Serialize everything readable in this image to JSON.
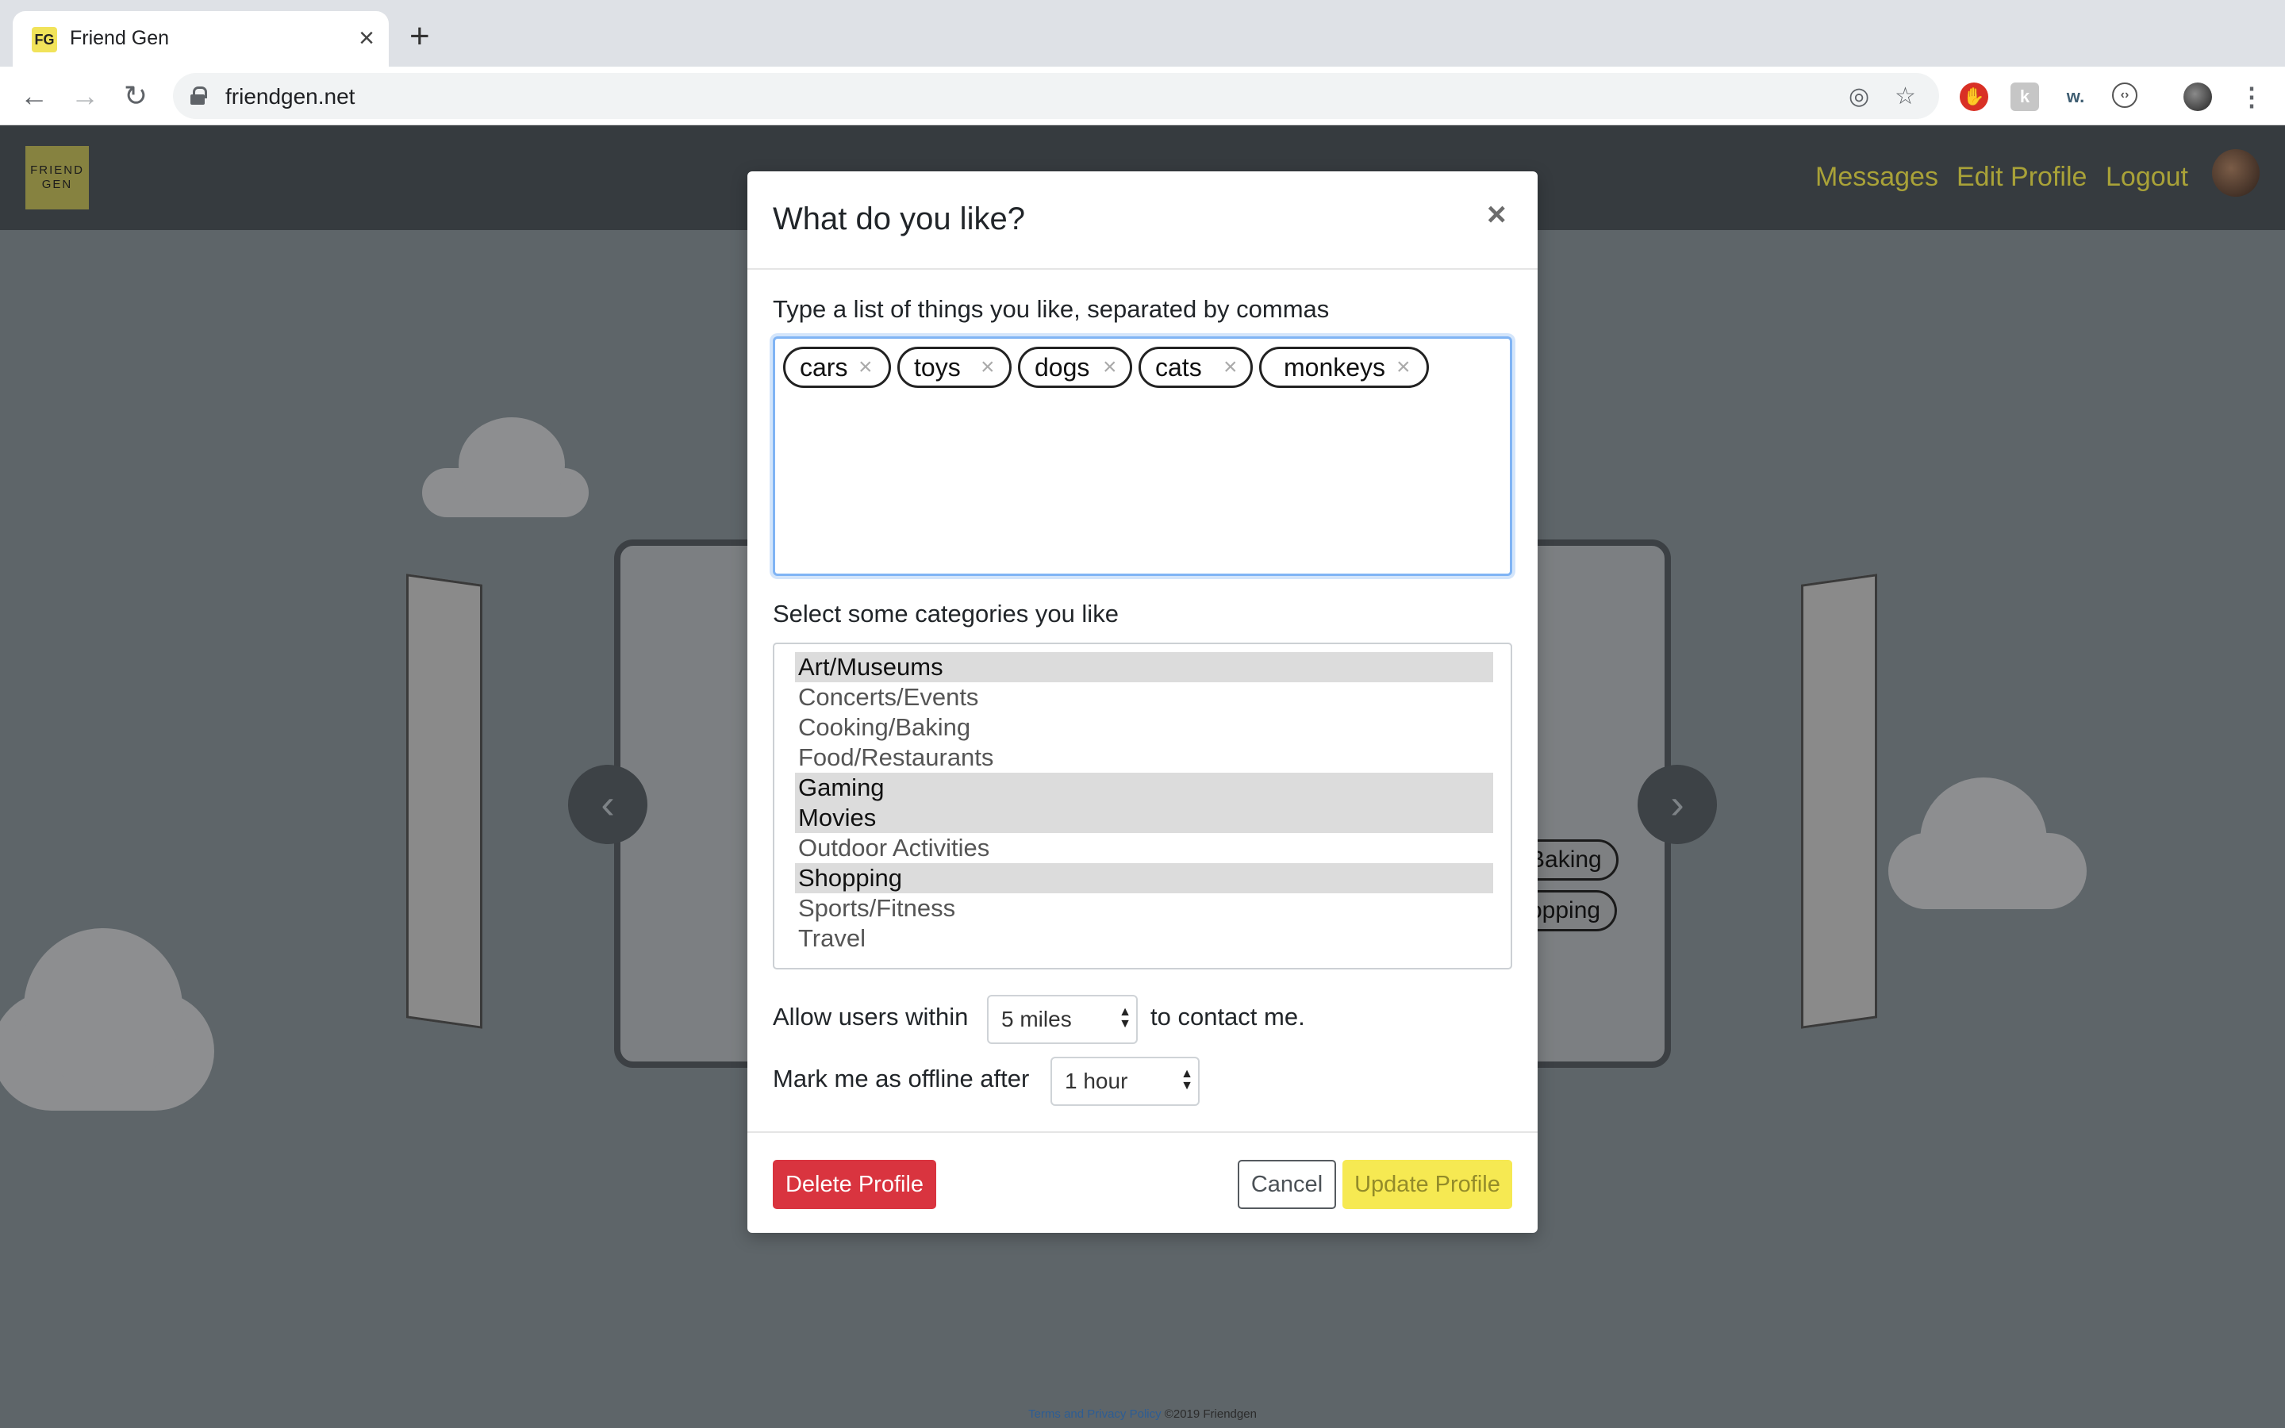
{
  "browser": {
    "tab_title": "Friend Gen",
    "favicon_text": "FG",
    "url": "friendgen.net"
  },
  "site": {
    "logo_line1": "FRIEND",
    "logo_line2": "GEN",
    "nav": {
      "messages": "Messages",
      "edit_profile": "Edit Profile",
      "logout": "Logout"
    },
    "nav_color": "#a9a238",
    "background_tags": [
      "Baking",
      "opping"
    ],
    "footer": {
      "terms_link": "Terms and Privacy Policy",
      "copyright": "©2019 Friendgen"
    }
  },
  "modal": {
    "title": "What do you like?",
    "likes_label": "Type a list of things you like, separated by commas",
    "tags": [
      "cars",
      "toys",
      "dogs",
      "cats",
      "monkeys"
    ],
    "categories_label": "Select some categories you like",
    "categories": [
      {
        "label": "Art/Museums",
        "selected": true
      },
      {
        "label": "Concerts/Events",
        "selected": false
      },
      {
        "label": "Cooking/Baking",
        "selected": false
      },
      {
        "label": "Food/Restaurants",
        "selected": false
      },
      {
        "label": "Gaming",
        "selected": true
      },
      {
        "label": "Movies",
        "selected": true
      },
      {
        "label": "Outdoor Activities",
        "selected": false
      },
      {
        "label": "Shopping",
        "selected": true
      },
      {
        "label": "Sports/Fitness",
        "selected": false
      },
      {
        "label": "Travel",
        "selected": false
      }
    ],
    "distance_prefix": "Allow users within",
    "distance_value": "5 miles",
    "distance_suffix": "to contact me.",
    "offline_prefix": "Mark me as offline after",
    "offline_value": "1 hour",
    "buttons": {
      "delete": "Delete Profile",
      "cancel": "Cancel",
      "update": "Update Profile"
    },
    "colors": {
      "danger": "#d9343f",
      "update": "#f6e952",
      "focus": "#80b4f4"
    }
  }
}
